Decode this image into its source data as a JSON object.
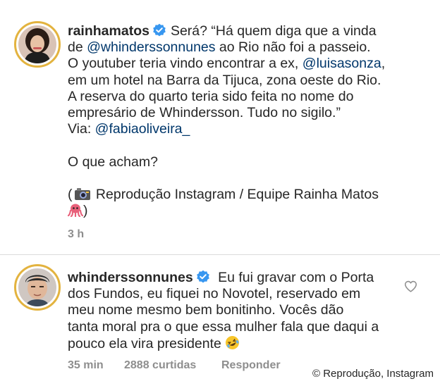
{
  "post": {
    "username": "rainhamatos",
    "verified_icon": "verified-badge",
    "lines": [
      {
        "pre": "Será? “Há quem diga que a vinda",
        "mention": "",
        "post": ""
      },
      {
        "pre": "de ",
        "mention": "@whinderssonnunes",
        "post": " ao Rio não foi a passeio."
      },
      {
        "pre": "O youtuber teria vindo encontrar a ex, ",
        "mention": "@luisasonza",
        "post": ","
      },
      {
        "pre": "em um hotel na Barra da Tijuca, zona oeste do Rio.",
        "mention": "",
        "post": ""
      },
      {
        "pre": "A reserva do quarto teria sido feita no nome do",
        "mention": "",
        "post": ""
      },
      {
        "pre": "empresário de Whindersson. Tudo no sigilo.”",
        "mention": "",
        "post": ""
      },
      {
        "pre": "Via: ",
        "mention": "@fabiaoliveira_",
        "post": ""
      }
    ],
    "question": "O que acham?",
    "credit_line_1": "Reprodução Instagram / Equipe Rainha Matos",
    "camera_icon": "camera-icon",
    "octopus_icon": "octopus-icon",
    "time": "3 h"
  },
  "comment": {
    "username": "whinderssonnunes",
    "verified_icon": "verified-badge",
    "lines": [
      "Eu fui gravar com o Porta",
      "dos Fundos, eu fiquei no Novotel, reservado em",
      "meu nome mesmo bem bonitinho. Vocês dão",
      "tanta moral pra o que essa mulher fala que daqui a",
      "pouco ela vira presidente"
    ],
    "emoji_icon": "rofl-emoji-icon",
    "time": "35 min",
    "likes": "2888 curtidas",
    "reply": "Responder",
    "like_icon": "heart-icon"
  },
  "watermark": "© Reprodução, Instagram",
  "colors": {
    "text": "#262626",
    "mention": "#00376b",
    "meta": "#8e8e8e",
    "verified": "#3897f0",
    "avatar_ring": "#e3b33f"
  }
}
